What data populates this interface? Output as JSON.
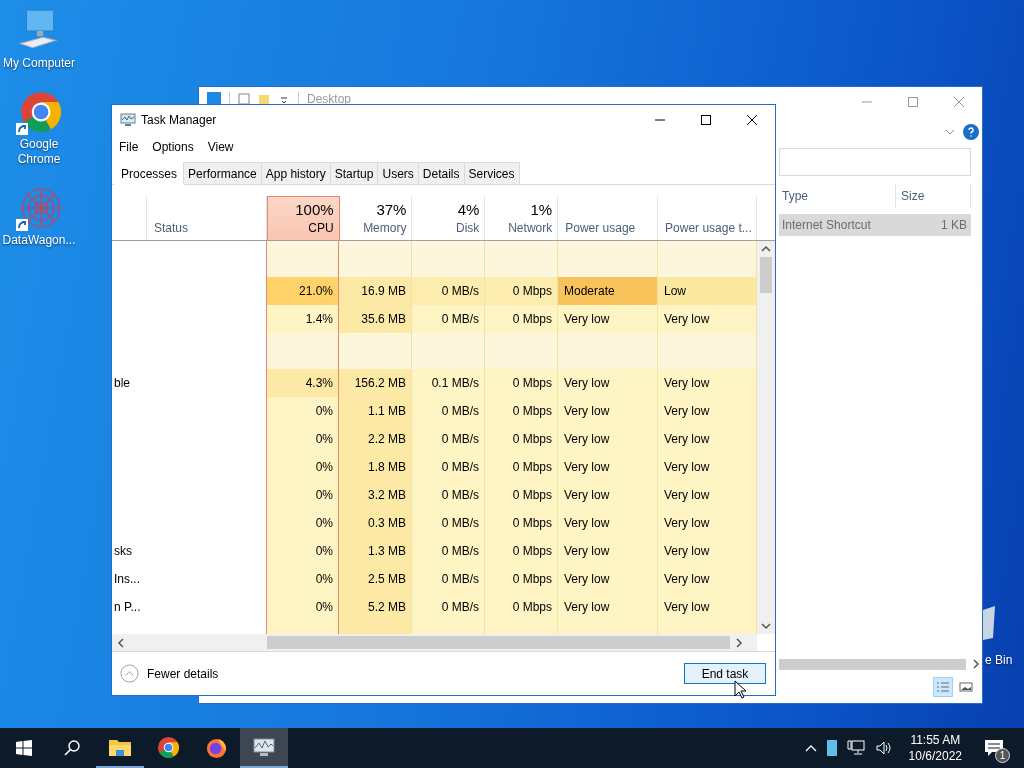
{
  "desktop_icons": [
    {
      "label": "My Computer",
      "kind": "computer",
      "shortcut": false
    },
    {
      "label": "Google Chrome",
      "kind": "chrome",
      "shortcut": true
    },
    {
      "label": "DataWagon...",
      "kind": "datawagon",
      "shortcut": true
    }
  ],
  "recycle_bin": {
    "label": "e Bin"
  },
  "explorer": {
    "title": "Desktop",
    "columns": [
      "Type",
      "Size"
    ],
    "rows": [
      {
        "type": "Internet Shortcut",
        "size": "1 KB",
        "selected": true
      }
    ],
    "views": [
      {
        "kind": "details",
        "selected": true
      },
      {
        "kind": "thumbnails",
        "selected": false
      }
    ]
  },
  "task_manager": {
    "title": "Task Manager",
    "menu": [
      "File",
      "Options",
      "View"
    ],
    "tabs": [
      {
        "label": "Processes",
        "selected": true
      },
      {
        "label": "Performance",
        "selected": false
      },
      {
        "label": "App history",
        "selected": false
      },
      {
        "label": "Startup",
        "selected": false
      },
      {
        "label": "Users",
        "selected": false
      },
      {
        "label": "Details",
        "selected": false
      },
      {
        "label": "Services",
        "selected": false
      }
    ],
    "status_column": {
      "label": "Status"
    },
    "columns": [
      {
        "kind": "metric",
        "percent": "100%",
        "label": "CPU",
        "alert": true
      },
      {
        "kind": "metric",
        "percent": "37%",
        "label": "Memory",
        "alert": false
      },
      {
        "kind": "metric",
        "percent": "4%",
        "label": "Disk",
        "alert": false
      },
      {
        "kind": "metric",
        "percent": "1%",
        "label": "Network",
        "alert": false
      },
      {
        "kind": "text",
        "label": "Power usage",
        "alert": false
      },
      {
        "kind": "text",
        "label": "Power usage t...",
        "alert": false
      }
    ],
    "rows": [
      {
        "kind": "group"
      },
      {
        "kind": "process",
        "cells": [
          {
            "text": "21.0%",
            "color": "#ffd36a"
          },
          {
            "text": "16.9 MB",
            "color": "#fce9a6"
          },
          {
            "text": "0 MB/s",
            "color": "#fcecae"
          },
          {
            "text": "0 Mbps",
            "color": "#fcecae"
          },
          {
            "text": "Moderate",
            "color": "#f9c35c"
          },
          {
            "text": "Low",
            "color": "#fbe9a0"
          }
        ]
      },
      {
        "kind": "process",
        "cells": [
          {
            "text": "1.4%",
            "color": "#fff4c4"
          },
          {
            "text": "35.6 MB",
            "color": "#fce9a6"
          },
          {
            "text": "0 MB/s",
            "color": "#fff4c4"
          },
          {
            "text": "0 Mbps",
            "color": "#fff4c4"
          },
          {
            "text": "Very low",
            "color": "#fff4c4"
          },
          {
            "text": "Very low",
            "color": "#fff4c4"
          }
        ]
      },
      {
        "kind": "group"
      },
      {
        "kind": "process",
        "name": "ble",
        "cells": [
          {
            "text": "4.3%",
            "color": "#fce9a6"
          },
          {
            "text": "156.2 MB",
            "color": "#fce9a6"
          },
          {
            "text": "0.1 MB/s",
            "color": "#fff4c4"
          },
          {
            "text": "0 Mbps",
            "color": "#fff4c4"
          },
          {
            "text": "Very low",
            "color": "#fff4c4"
          },
          {
            "text": "Very low",
            "color": "#fff4c4"
          }
        ]
      },
      {
        "kind": "process",
        "cells": [
          {
            "text": "0%",
            "color": "#fff4c4"
          },
          {
            "text": "1.1 MB",
            "color": "#fce9a6"
          },
          {
            "text": "0 MB/s",
            "color": "#fff4c4"
          },
          {
            "text": "0 Mbps",
            "color": "#fff4c4"
          },
          {
            "text": "Very low",
            "color": "#fff4c4"
          },
          {
            "text": "Very low",
            "color": "#fff4c4"
          }
        ]
      },
      {
        "kind": "process",
        "cells": [
          {
            "text": "0%",
            "color": "#fff4c4"
          },
          {
            "text": "2.2 MB",
            "color": "#fce9a6"
          },
          {
            "text": "0 MB/s",
            "color": "#fff4c4"
          },
          {
            "text": "0 Mbps",
            "color": "#fff4c4"
          },
          {
            "text": "Very low",
            "color": "#fff4c4"
          },
          {
            "text": "Very low",
            "color": "#fff4c4"
          }
        ]
      },
      {
        "kind": "process",
        "cells": [
          {
            "text": "0%",
            "color": "#fff4c4"
          },
          {
            "text": "1.8 MB",
            "color": "#fce9a6"
          },
          {
            "text": "0 MB/s",
            "color": "#fff4c4"
          },
          {
            "text": "0 Mbps",
            "color": "#fff4c4"
          },
          {
            "text": "Very low",
            "color": "#fff4c4"
          },
          {
            "text": "Very low",
            "color": "#fff4c4"
          }
        ]
      },
      {
        "kind": "process",
        "cells": [
          {
            "text": "0%",
            "color": "#fff4c4"
          },
          {
            "text": "3.2 MB",
            "color": "#fce9a6"
          },
          {
            "text": "0 MB/s",
            "color": "#fff4c4"
          },
          {
            "text": "0 Mbps",
            "color": "#fff4c4"
          },
          {
            "text": "Very low",
            "color": "#fff4c4"
          },
          {
            "text": "Very low",
            "color": "#fff4c4"
          }
        ]
      },
      {
        "kind": "process",
        "cells": [
          {
            "text": "0%",
            "color": "#fff4c4"
          },
          {
            "text": "0.3 MB",
            "color": "#fce9a6"
          },
          {
            "text": "0 MB/s",
            "color": "#fff4c4"
          },
          {
            "text": "0 Mbps",
            "color": "#fff4c4"
          },
          {
            "text": "Very low",
            "color": "#fff4c4"
          },
          {
            "text": "Very low",
            "color": "#fff4c4"
          }
        ]
      },
      {
        "kind": "process",
        "name": "sks",
        "cells": [
          {
            "text": "0%",
            "color": "#fff4c4"
          },
          {
            "text": "1.3 MB",
            "color": "#fce9a6"
          },
          {
            "text": "0 MB/s",
            "color": "#fff4c4"
          },
          {
            "text": "0 Mbps",
            "color": "#fff4c4"
          },
          {
            "text": "Very low",
            "color": "#fff4c4"
          },
          {
            "text": "Very low",
            "color": "#fff4c4"
          }
        ]
      },
      {
        "kind": "process",
        "name": "Ins...",
        "cells": [
          {
            "text": "0%",
            "color": "#fff4c4"
          },
          {
            "text": "2.5 MB",
            "color": "#fce9a6"
          },
          {
            "text": "0 MB/s",
            "color": "#fff4c4"
          },
          {
            "text": "0 Mbps",
            "color": "#fff4c4"
          },
          {
            "text": "Very low",
            "color": "#fff4c4"
          },
          {
            "text": "Very low",
            "color": "#fff4c4"
          }
        ]
      },
      {
        "kind": "process",
        "name": "n P...",
        "cells": [
          {
            "text": "0%",
            "color": "#fff4c4"
          },
          {
            "text": "5.2 MB",
            "color": "#fce9a6"
          },
          {
            "text": "0 MB/s",
            "color": "#fff4c4"
          },
          {
            "text": "0 Mbps",
            "color": "#fff4c4"
          },
          {
            "text": "Very low",
            "color": "#fff4c4"
          },
          {
            "text": "Very low",
            "color": "#fff4c4"
          }
        ]
      }
    ],
    "fewer_details": "Fewer details",
    "end_task": "End task"
  },
  "taskbar": {
    "apps": [
      {
        "kind": "explorer",
        "active": false,
        "running": true
      },
      {
        "kind": "chrome",
        "active": false,
        "running": false
      },
      {
        "kind": "firefox",
        "active": false,
        "running": false
      },
      {
        "kind": "taskmanager",
        "active": true,
        "running": true
      }
    ],
    "time": "11:55 AM",
    "date": "10/6/2022",
    "notifications": "1"
  }
}
